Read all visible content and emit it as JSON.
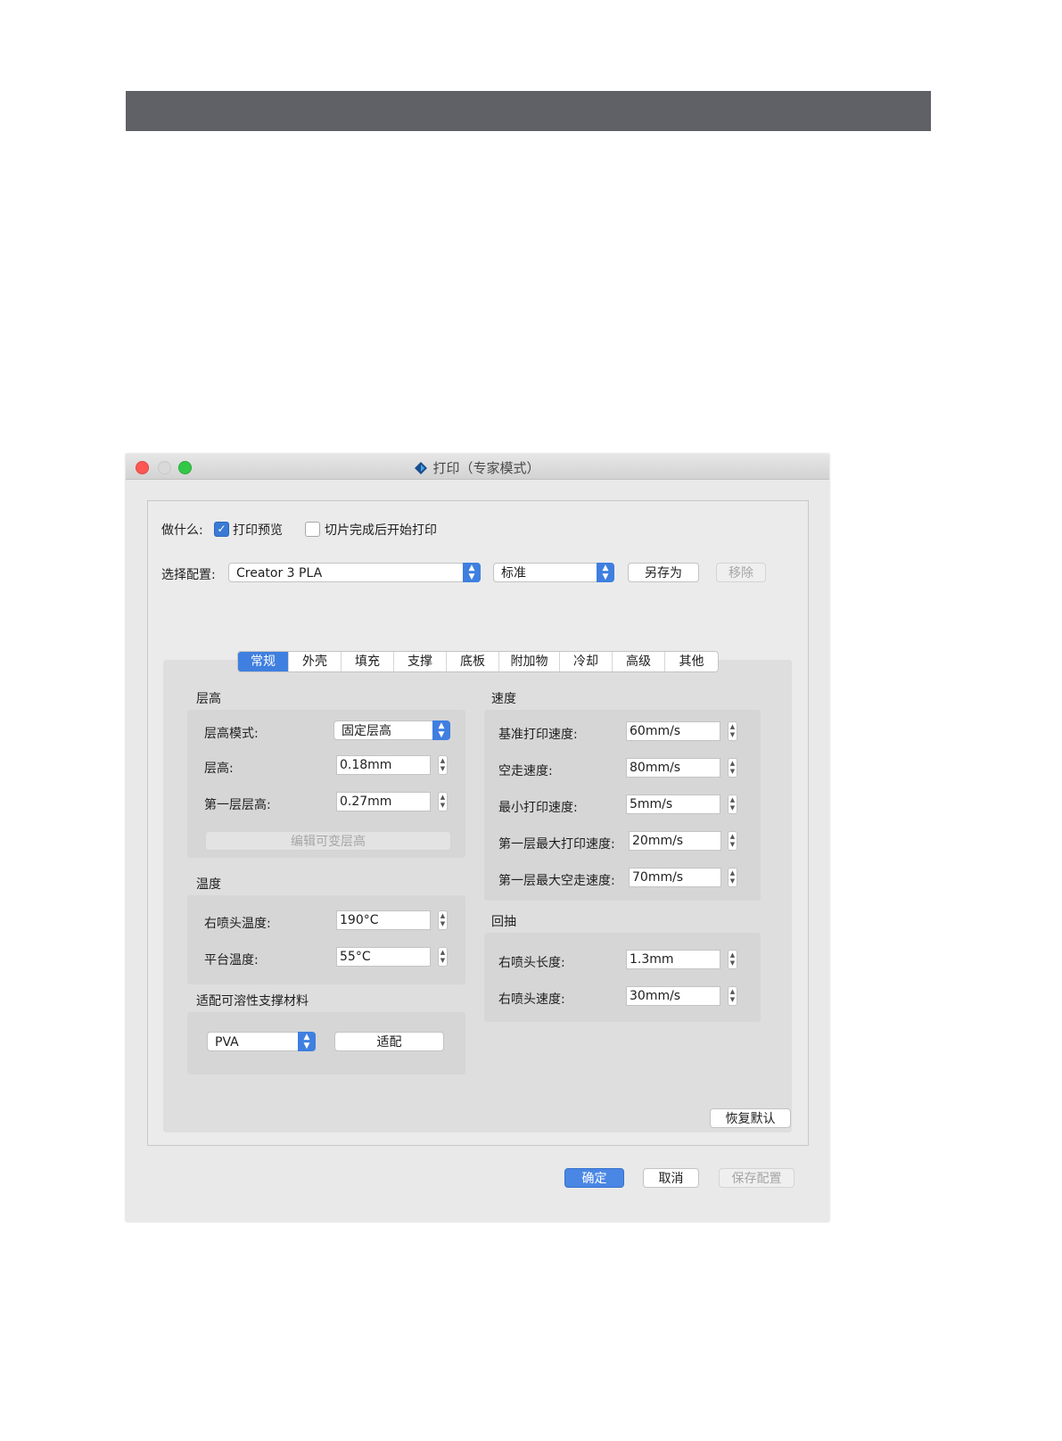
{
  "window": {
    "title": "打印（专家模式）"
  },
  "what_to_do": {
    "label": "做什么:",
    "preview_label": "打印预览",
    "preview_checked": true,
    "start_after_slice_label": "切片完成后开始打印",
    "start_after_slice_checked": false
  },
  "config": {
    "label": "选择配置:",
    "profile": "Creator 3 PLA",
    "quality": "标准",
    "save_as": "另存为",
    "remove": "移除"
  },
  "tabs": [
    {
      "label": "常规",
      "active": true
    },
    {
      "label": "外壳"
    },
    {
      "label": "填充"
    },
    {
      "label": "支撑"
    },
    {
      "label": "底板"
    },
    {
      "label": "附加物"
    },
    {
      "label": "冷却"
    },
    {
      "label": "高级"
    },
    {
      "label": "其他"
    }
  ],
  "layer": {
    "title": "层高",
    "mode_label": "层高模式:",
    "mode_value": "固定层高",
    "height_label": "层高:",
    "height_value": "0.18mm",
    "first_label": "第一层层高:",
    "first_value": "0.27mm",
    "edit_variable": "编辑可变层高"
  },
  "temperature": {
    "title": "温度",
    "nozzle_label": "右喷头温度:",
    "nozzle_value": "190°C",
    "bed_label": "平台温度:",
    "bed_value": "55°C"
  },
  "soluble": {
    "title": "适配可溶性支撑材料",
    "material": "PVA",
    "adapt": "适配"
  },
  "speed": {
    "title": "速度",
    "rows": [
      {
        "label": "基准打印速度:",
        "value": "60mm/s"
      },
      {
        "label": "空走速度:",
        "value": "80mm/s"
      },
      {
        "label": "最小打印速度:",
        "value": "5mm/s"
      },
      {
        "label": "第一层最大打印速度:",
        "value": "20mm/s"
      },
      {
        "label": "第一层最大空走速度:",
        "value": "70mm/s"
      }
    ]
  },
  "retraction": {
    "title": "回抽",
    "rows": [
      {
        "label": "右喷头长度:",
        "value": "1.3mm"
      },
      {
        "label": "右喷头速度:",
        "value": "30mm/s"
      }
    ]
  },
  "footer": {
    "restore": "恢复默认",
    "ok": "确定",
    "cancel": "取消",
    "save_config": "保存配置"
  },
  "icons": {
    "checkmark": "checkmark-icon",
    "stepper": "stepper-arrows-icon",
    "app": "flashprint-logo-icon"
  }
}
